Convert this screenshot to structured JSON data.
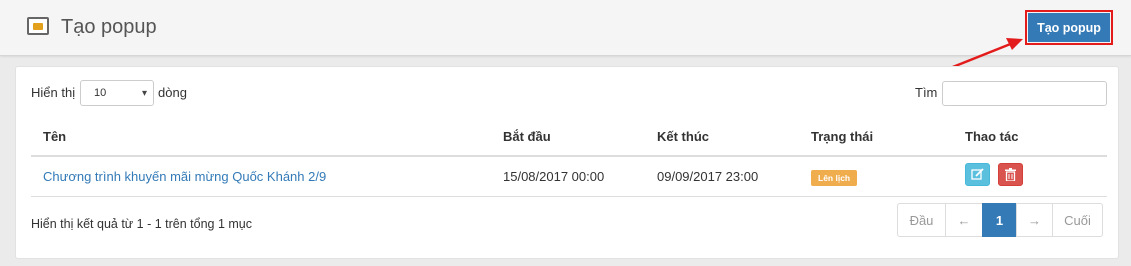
{
  "header": {
    "title": "Tạo popup",
    "create_button": "Tạo popup"
  },
  "colors": {
    "primary": "#337ab7",
    "highlight_border": "#e31b1b",
    "badge_warning": "#f0ad4e",
    "btn_info": "#5bc0de",
    "btn_danger": "#d9534f"
  },
  "table_controls": {
    "length_label": "Hiển thị",
    "length_value": "10",
    "length_suffix": "dòng",
    "search_label": "Tìm",
    "search_value": ""
  },
  "table": {
    "columns": [
      "Tên",
      "Bắt đầu",
      "Kết thúc",
      "Trạng thái",
      "Thao tác"
    ],
    "rows": [
      {
        "name": "Chương trình khuyến mãi mừng Quốc Khánh 2/9",
        "start": "15/08/2017 00:00",
        "end": "09/09/2017 23:00",
        "status": "Lên lịch",
        "actions": [
          "edit-icon",
          "trash-icon"
        ]
      }
    ]
  },
  "footer": {
    "info": "Hiển thị kết quả từ 1 - 1 trên tổng 1 mục"
  },
  "pagination": {
    "first": "Đầu",
    "prev": "←",
    "current": "1",
    "next": "→",
    "last": "Cuối"
  }
}
